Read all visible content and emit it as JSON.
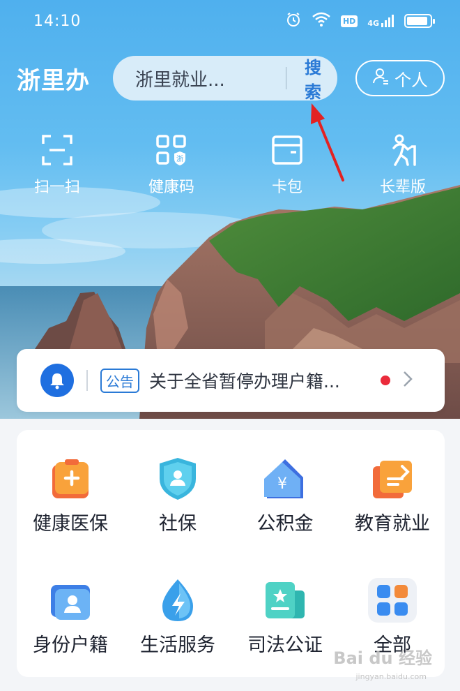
{
  "status_bar": {
    "time": "14:10",
    "network_badge": "HD",
    "signal_label": "4G"
  },
  "header": {
    "logo": "浙里办",
    "search_placeholder": "浙里就业...",
    "search_button": "搜索",
    "personal_button": "个人"
  },
  "quick_actions": [
    {
      "label": "扫一扫",
      "icon": "scan-icon"
    },
    {
      "label": "健康码",
      "icon": "health-code-icon",
      "badge": "浙"
    },
    {
      "label": "卡包",
      "icon": "card-wallet-icon"
    },
    {
      "label": "长辈版",
      "icon": "elder-mode-icon"
    }
  ],
  "notice": {
    "tag": "公告",
    "text": "关于全省暂停办理户籍...",
    "unread": true
  },
  "services": [
    {
      "label": "健康医保",
      "icon": "medical-insurance-icon"
    },
    {
      "label": "社保",
      "icon": "social-security-icon"
    },
    {
      "label": "公积金",
      "icon": "housing-fund-icon"
    },
    {
      "label": "教育就业",
      "icon": "education-employment-icon"
    },
    {
      "label": "身份户籍",
      "icon": "identity-registration-icon"
    },
    {
      "label": "生活服务",
      "icon": "life-services-icon"
    },
    {
      "label": "司法公证",
      "icon": "judicial-notary-icon"
    },
    {
      "label": "全部",
      "icon": "all-services-icon"
    }
  ],
  "watermark": {
    "main": "Bai du 经验",
    "sub": "jingyan.baidu.com"
  },
  "colors": {
    "accent": "#2a7ad6",
    "sky": "#4fb0ee",
    "alert": "#ea2b3b"
  }
}
